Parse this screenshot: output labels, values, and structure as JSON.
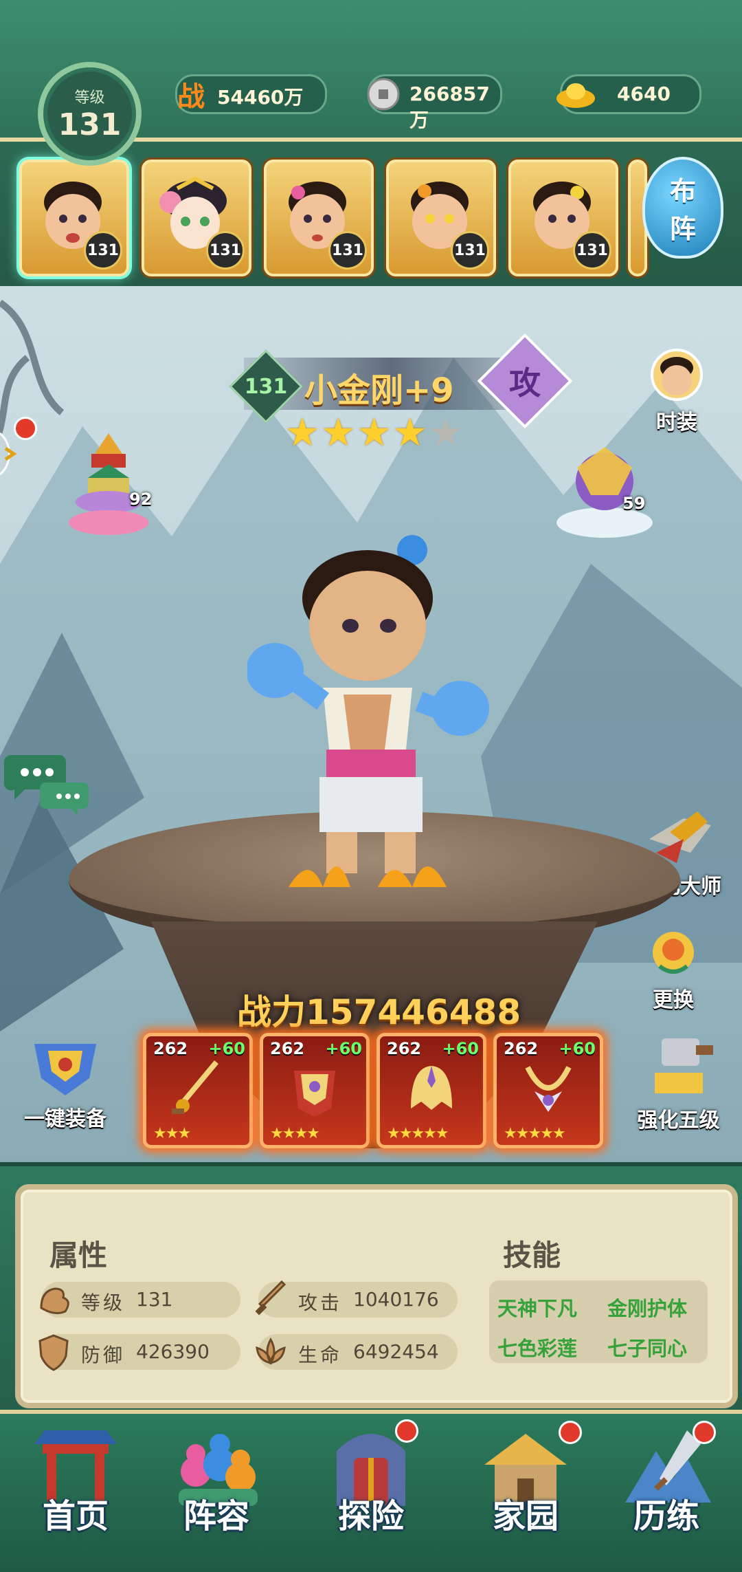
{
  "header": {
    "level_label": "等级",
    "level_value": "131",
    "combat_icon": "战",
    "combat_value": "54460万",
    "coin_value": "266857万",
    "ingot_value": "4640"
  },
  "heroes": [
    {
      "level": "131",
      "selected": true
    },
    {
      "level": "131",
      "selected": false
    },
    {
      "level": "131",
      "selected": false
    },
    {
      "level": "131",
      "selected": false
    },
    {
      "level": "131",
      "selected": false
    }
  ],
  "lineup_button": {
    "line1": "布",
    "line2": "阵"
  },
  "hero": {
    "level": "131",
    "name": "小金刚+9",
    "type_badge": "攻",
    "stars_filled": 4,
    "stars_total": 5
  },
  "side_left": {
    "pagoda_count": "92"
  },
  "side_right": {
    "fashion_label": "时装",
    "mount_count": "59",
    "master_label": "强化大师",
    "swap_label": "更换",
    "level5_label": "强化五级"
  },
  "combat_power_label": "战力157446488",
  "equip_all_label": "一键装备",
  "equipment": [
    {
      "level": "262",
      "bonus": "+60",
      "stars": 3
    },
    {
      "level": "262",
      "bonus": "+60",
      "stars": 4
    },
    {
      "level": "262",
      "bonus": "+60",
      "stars": 5
    },
    {
      "level": "262",
      "bonus": "+60",
      "stars": 5
    }
  ],
  "attributes": {
    "title": "属性",
    "level_label": "等级",
    "level_value": "131",
    "attack_label": "攻击",
    "attack_value": "1040176",
    "defense_label": "防御",
    "defense_value": "426390",
    "hp_label": "生命",
    "hp_value": "6492454"
  },
  "skills": {
    "title": "技能",
    "s1": "天神下凡",
    "s2": "金刚护体",
    "s3": "七色彩莲",
    "s4": "七子同心"
  },
  "nav": {
    "home": "首页",
    "lineup": "阵容",
    "explore": "探险",
    "homeland": "家园",
    "training": "历练"
  },
  "colors": {
    "accent_green": "#2f7359",
    "gold": "#ffd66a",
    "skill_green": "#36a23a",
    "notification_red": "#e23a2a"
  },
  "icons": {
    "coin": "coin-icon",
    "ingot": "ingot-icon",
    "chat": "chat-icon"
  }
}
